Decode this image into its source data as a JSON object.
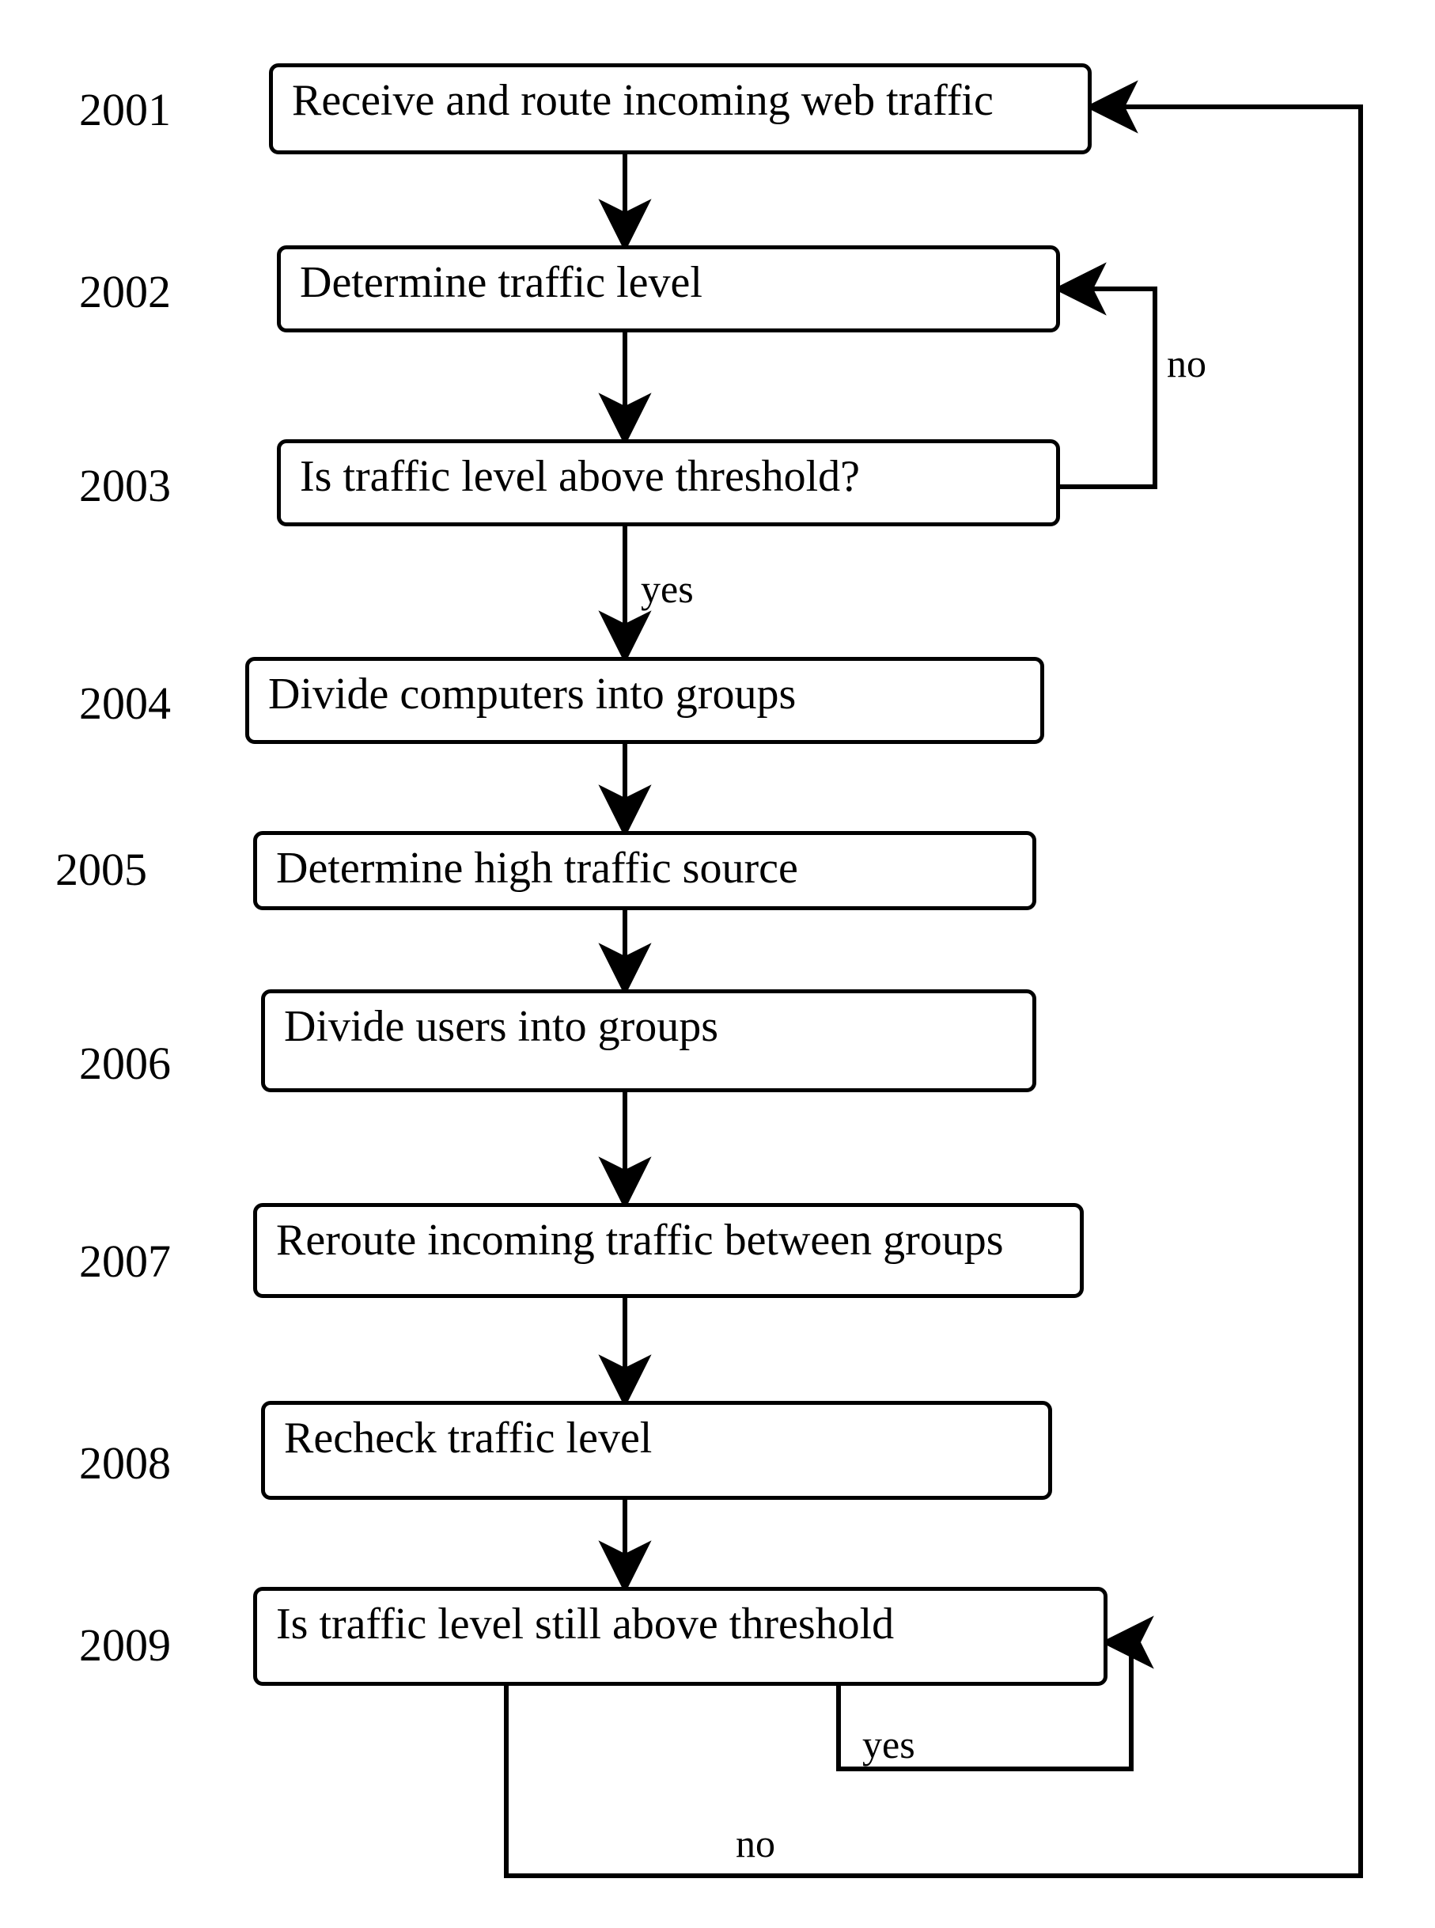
{
  "nodes": {
    "n2001": {
      "label": "2001",
      "text": "Receive and route incoming web traffic"
    },
    "n2002": {
      "label": "2002",
      "text": "Determine traffic level"
    },
    "n2003": {
      "label": "2003",
      "text": "Is traffic level above threshold?"
    },
    "n2004": {
      "label": "2004",
      "text": "Divide computers into groups"
    },
    "n2005": {
      "label": "2005",
      "text": "Determine high traffic source"
    },
    "n2006": {
      "label": "2006",
      "text": "Divide users into groups"
    },
    "n2007": {
      "label": "2007",
      "text": "Reroute incoming traffic between groups"
    },
    "n2008": {
      "label": "2008",
      "text": "Recheck traffic level"
    },
    "n2009": {
      "label": "2009",
      "text": "Is traffic level still above threshold"
    }
  },
  "edges": {
    "e2003_no": "no",
    "e2003_yes": "yes",
    "e2009_yes": "yes",
    "e2009_no": "no"
  },
  "flow": [
    {
      "from": "2001",
      "to": "2002"
    },
    {
      "from": "2002",
      "to": "2003"
    },
    {
      "from": "2003",
      "to": "2002",
      "label": "no"
    },
    {
      "from": "2003",
      "to": "2004",
      "label": "yes"
    },
    {
      "from": "2004",
      "to": "2005"
    },
    {
      "from": "2005",
      "to": "2006"
    },
    {
      "from": "2006",
      "to": "2007"
    },
    {
      "from": "2007",
      "to": "2008"
    },
    {
      "from": "2008",
      "to": "2009"
    },
    {
      "from": "2009",
      "to": "2009",
      "label": "yes"
    },
    {
      "from": "2009",
      "to": "2001",
      "label": "no"
    }
  ]
}
